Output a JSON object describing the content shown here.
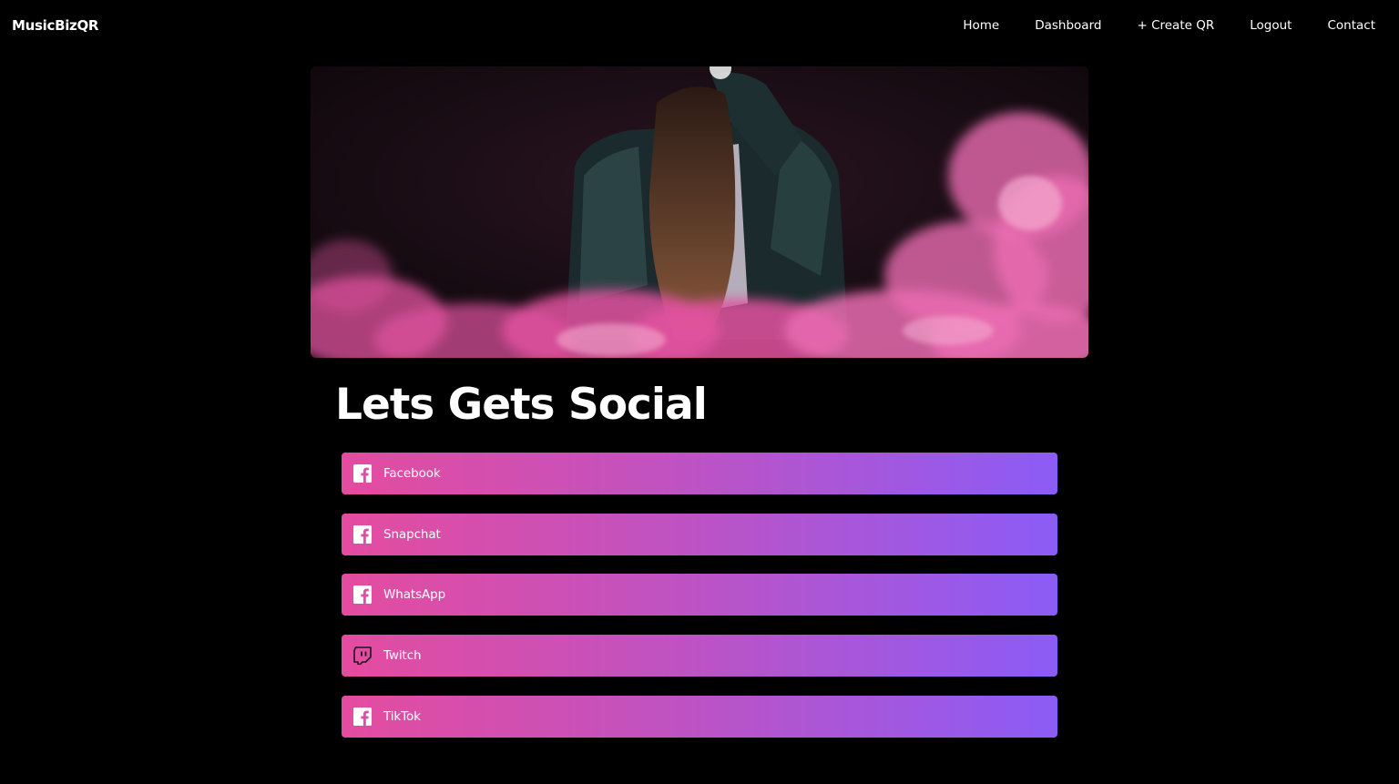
{
  "navbar": {
    "brand": "MusicBizQR",
    "links": [
      {
        "label": "Home"
      },
      {
        "label": "Dashboard"
      },
      {
        "label": "+ Create QR"
      },
      {
        "label": "Logout"
      },
      {
        "label": "Contact"
      }
    ]
  },
  "main": {
    "title": "Lets Gets Social",
    "buttons": [
      {
        "label": "Facebook",
        "icon": "facebook-icon"
      },
      {
        "label": "Snapchat",
        "icon": "facebook-icon"
      },
      {
        "label": "WhatsApp",
        "icon": "facebook-icon"
      },
      {
        "label": "Twitch",
        "icon": "twitch-icon"
      },
      {
        "label": "TikTok",
        "icon": "facebook-icon"
      }
    ]
  },
  "colors": {
    "background": "#000000",
    "gradient_start": "#e44c9f",
    "gradient_end": "#8b5cf6",
    "smoke": "#e0529f"
  }
}
